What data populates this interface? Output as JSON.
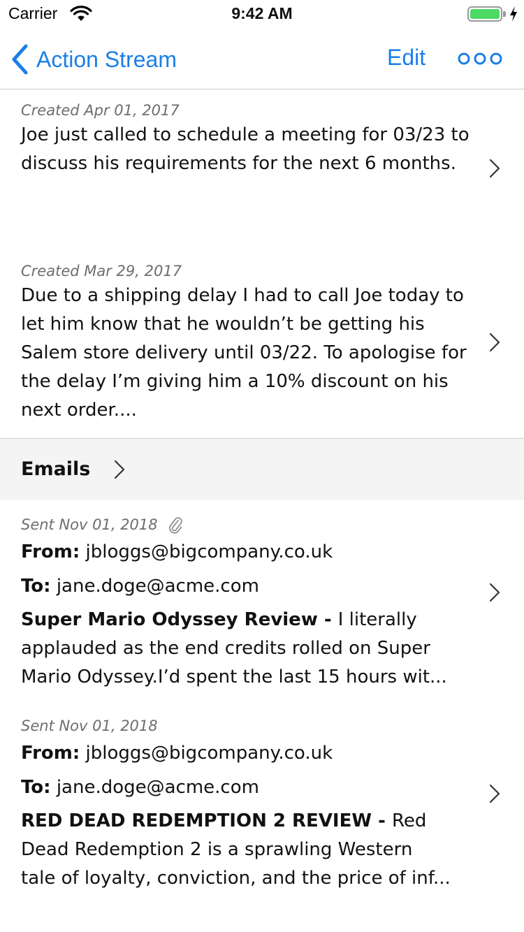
{
  "status_bar": {
    "carrier": "Carrier",
    "time": "9:42 AM",
    "battery_level": 1.0,
    "battery_color": "#4cd964"
  },
  "nav": {
    "back_label": "Action Stream",
    "edit_label": "Edit",
    "more_icon": "more-horizontal-icon",
    "accent_color": "#1a7fe6"
  },
  "notes": [
    {
      "meta": "Created Apr 01, 2017",
      "text": "Joe just called to schedule a meeting for 03/23 to discuss his requirements for the next 6 months."
    },
    {
      "meta": "Created Mar 29, 2017",
      "text": "Due to a shipping delay I had to call Joe today to let him know that he wouldn’t be getting his Salem store delivery until 03/22. To apologise for the delay I’m giving him a 10% discount on his next order...."
    }
  ],
  "emails_section": {
    "title": "Emails"
  },
  "emails": [
    {
      "meta": "Sent Nov 01, 2018",
      "has_attachment": true,
      "from_label": "From:",
      "from": "jbloggs@bigcompany.co.uk",
      "to_label": "To:",
      "to": "jane.doge@acme.com",
      "subject": "Super Mario Odyssey Review - ",
      "preview_line1": "I literally",
      "preview_line2": "applauded as the end credits rolled on Super",
      "preview_line3": "Mario Odyssey.I’d spent the last 15 hours wit..."
    },
    {
      "meta": "Sent Nov 01, 2018",
      "has_attachment": false,
      "from_label": "From:",
      "from": "jbloggs@bigcompany.co.uk",
      "to_label": "To:",
      "to": "jane.doge@acme.com",
      "subject": "RED DEAD REDEMPTION 2 REVIEW - ",
      "preview_line1": "Red",
      "preview_line2": "Dead Redemption 2 is a sprawling Western",
      "preview_line3": "tale of loyalty, conviction, and the price of inf..."
    }
  ]
}
